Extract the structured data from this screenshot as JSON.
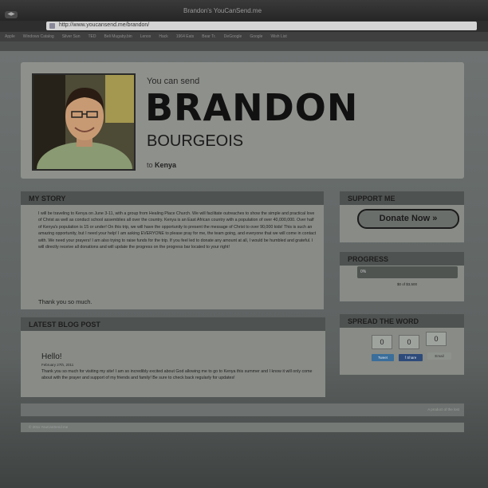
{
  "browser": {
    "window_title": "Brandon's YouCanSend.me",
    "url": "http://www.youcansend.me/brandon/",
    "bookmarks": [
      "Apple",
      "Windows Catalog",
      "Silver Sun",
      "TED",
      "Beli Mugaby.bin",
      "Lenox",
      "Hack",
      "1964 Eats",
      "Bear Tr.",
      "DeGoogle",
      "Google",
      "Wish List"
    ]
  },
  "header": {
    "you_can_send": "You can send",
    "first_name": "BRANDON",
    "last_name": "BOURGEOIS",
    "to_prefix": "to",
    "destination": "Kenya"
  },
  "story": {
    "heading": "MY STORY",
    "body": "I will be traveling to Kenya on June 3-11, with a group from Healing Place Church. We will facilitate outreaches to show the simple and practical love of Christ as well as conduct school assemblies all over the country. Kenya is an East African country with a population of over 40,000,000. Over half of Kenya's population is 15 or under! On this trip, we will have the opportunity to present the message of Christ to over 90,000 kids! This is such an amazing opportunity, but I need your help! I am asking EVERYONE to please pray for me, the team going, and everyone that we will come in contact with. We need your prayers! I am also trying to raise funds for the trip. If you feel led to donate any amount at all, I would be humbled and grateful. I will directly receive all donations and will update the progress on the progress bar located to your right!",
    "thanks": "Thank you so much."
  },
  "blog": {
    "heading": "LATEST BLOG POST",
    "title": "Hello!",
    "date": "February 27th, 2011",
    "body": "Thank you so much for visiting my site! I am so incredibly excited about God allowing me to go to Kenya this summer and I know it will only come about with the prayer and support of my friends and family! Be sure to check back regularly for updates!"
  },
  "support": {
    "heading": "SUPPORT ME",
    "donate_label": "Donate Now »"
  },
  "progress": {
    "heading": "PROGRESS",
    "percent_label": "0%",
    "fraction": 0,
    "caption": "$0 of $3,500"
  },
  "share": {
    "heading": "SPREAD THE WORD",
    "counts": [
      "0",
      "0",
      "0"
    ],
    "tweet_label": "Tweet",
    "facebook_label": "Share",
    "email_label": "Email",
    "tweet_color": "#3b6e9a",
    "facebook_color": "#2d4a7a",
    "email_color": "#8e928d"
  },
  "footer": {
    "credit": "A product of the lost",
    "copyright": "© 2011 YouCanSend.me"
  }
}
